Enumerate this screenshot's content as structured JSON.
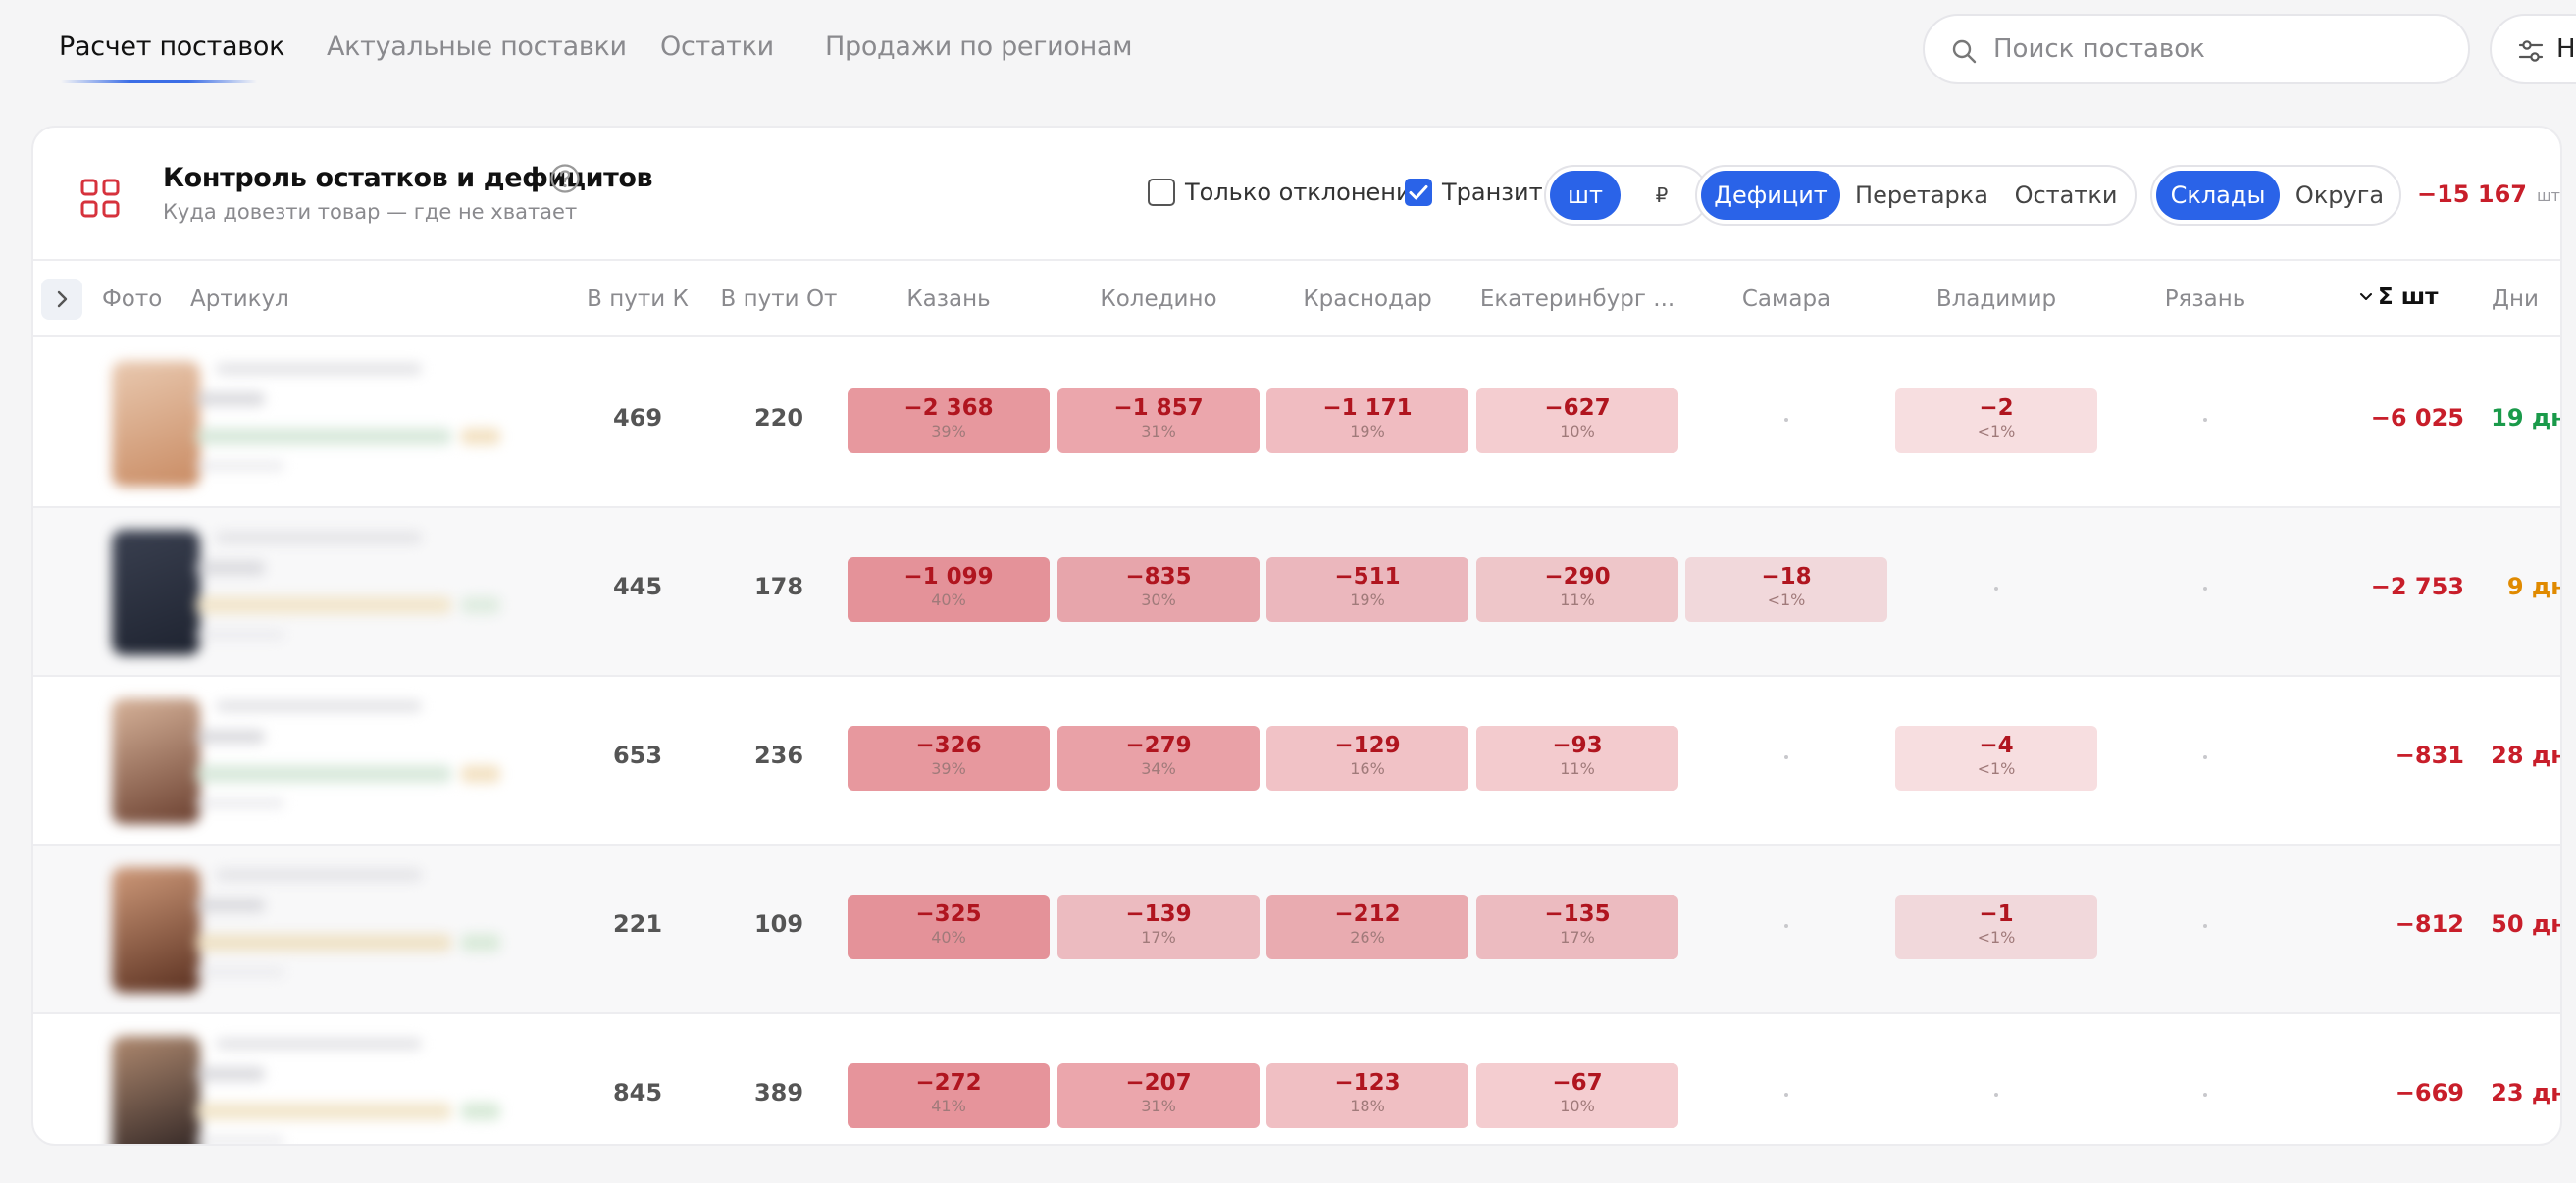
{
  "nav": {
    "tabs": [
      {
        "label": "Расчет поставок",
        "active": true
      },
      {
        "label": "Актуальные поставки",
        "active": false
      },
      {
        "label": "Остатки",
        "active": false
      },
      {
        "label": "Продажи по регионам",
        "active": false
      }
    ],
    "search_placeholder": "Поиск поставок",
    "settings_label": "Н"
  },
  "card": {
    "title": "Контроль остатков и дефицитов",
    "subtitle": "Куда довезти товар — где не хватает",
    "filters": {
      "only_deviations": {
        "label": "Только отклонения",
        "checked": false
      },
      "transit": {
        "label": "Транзит",
        "checked": true
      }
    },
    "unit_toggle": {
      "options": [
        "шт",
        "₽"
      ],
      "selected": "шт"
    },
    "mode_toggle": {
      "options": [
        "Дефицит",
        "Перетарка",
        "Остатки"
      ],
      "selected": "Дефицит"
    },
    "scope_toggle": {
      "options": [
        "Склады",
        "Округа"
      ],
      "selected": "Склады"
    },
    "total": {
      "value": "−15 167",
      "unit": "шт"
    }
  },
  "columns": {
    "photo": "Фото",
    "article": "Артикул",
    "in_transit_to": "В пути К",
    "in_transit_from": "В пути От",
    "warehouses": [
      "Казань",
      "Коледино",
      "Краснодар",
      "Екатеринбург ...",
      "Самара",
      "Владимир",
      "Рязань"
    ],
    "sum": "Σ шт",
    "days": "Дни"
  },
  "colors": {
    "accent": "#2a63e8",
    "deficit_text": "#c81e2a",
    "days_green": "#1a9a4a",
    "days_orange": "#e08a00",
    "days_red": "#c81e2a"
  },
  "rows": [
    {
      "to": "469",
      "from": "220",
      "cells": [
        {
          "v": "−2 368",
          "p": "39%",
          "level": 0.39
        },
        {
          "v": "−1 857",
          "p": "31%",
          "level": 0.31
        },
        {
          "v": "−1 171",
          "p": "19%",
          "level": 0.19
        },
        {
          "v": "−627",
          "p": "10%",
          "level": 0.1
        },
        {
          "v": "",
          "p": "",
          "level": 0
        },
        {
          "v": "−2",
          "p": "<1%",
          "level": 0.01
        },
        {
          "v": "",
          "p": "",
          "level": 0
        }
      ],
      "sum": "−6 025",
      "days": "19",
      "days_unit": "дн.",
      "days_status": "green"
    },
    {
      "to": "445",
      "from": "178",
      "cells": [
        {
          "v": "−1 099",
          "p": "40%",
          "level": 0.4
        },
        {
          "v": "−835",
          "p": "30%",
          "level": 0.3
        },
        {
          "v": "−511",
          "p": "19%",
          "level": 0.19
        },
        {
          "v": "−290",
          "p": "11%",
          "level": 0.11
        },
        {
          "v": "−18",
          "p": "<1%",
          "level": 0.01
        },
        {
          "v": "",
          "p": "",
          "level": 0
        },
        {
          "v": "",
          "p": "",
          "level": 0
        }
      ],
      "sum": "−2 753",
      "days": "9",
      "days_unit": "дн.",
      "days_status": "orange"
    },
    {
      "to": "653",
      "from": "236",
      "cells": [
        {
          "v": "−326",
          "p": "39%",
          "level": 0.39
        },
        {
          "v": "−279",
          "p": "34%",
          "level": 0.34
        },
        {
          "v": "−129",
          "p": "16%",
          "level": 0.16
        },
        {
          "v": "−93",
          "p": "11%",
          "level": 0.11
        },
        {
          "v": "",
          "p": "",
          "level": 0
        },
        {
          "v": "−4",
          "p": "<1%",
          "level": 0.01
        },
        {
          "v": "",
          "p": "",
          "level": 0
        }
      ],
      "sum": "−831",
      "days": "28",
      "days_unit": "дн.",
      "days_status": "red"
    },
    {
      "to": "221",
      "from": "109",
      "cells": [
        {
          "v": "−325",
          "p": "40%",
          "level": 0.4
        },
        {
          "v": "−139",
          "p": "17%",
          "level": 0.17
        },
        {
          "v": "−212",
          "p": "26%",
          "level": 0.26
        },
        {
          "v": "−135",
          "p": "17%",
          "level": 0.17
        },
        {
          "v": "",
          "p": "",
          "level": 0
        },
        {
          "v": "−1",
          "p": "<1%",
          "level": 0.01
        },
        {
          "v": "",
          "p": "",
          "level": 0
        }
      ],
      "sum": "−812",
      "days": "50",
      "days_unit": "дн.",
      "days_status": "red"
    },
    {
      "to": "845",
      "from": "389",
      "cells": [
        {
          "v": "−272",
          "p": "41%",
          "level": 0.41
        },
        {
          "v": "−207",
          "p": "31%",
          "level": 0.31
        },
        {
          "v": "−123",
          "p": "18%",
          "level": 0.18
        },
        {
          "v": "−67",
          "p": "10%",
          "level": 0.1
        },
        {
          "v": "",
          "p": "",
          "level": 0
        },
        {
          "v": "",
          "p": "",
          "level": 0
        },
        {
          "v": "",
          "p": "",
          "level": 0
        }
      ],
      "sum": "−669",
      "days": "23",
      "days_unit": "дн.",
      "days_status": "red"
    }
  ]
}
